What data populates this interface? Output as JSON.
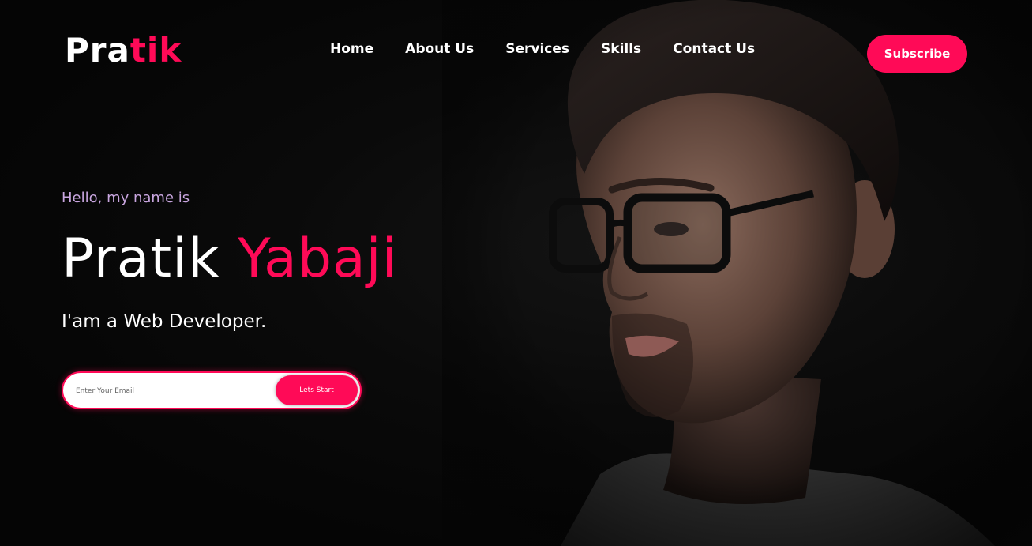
{
  "brand": {
    "logo_first": "Pra",
    "logo_second": "tik",
    "accent_color": "#ff0a57"
  },
  "nav": {
    "items": [
      {
        "label": "Home"
      },
      {
        "label": "About Us"
      },
      {
        "label": "Services"
      },
      {
        "label": "Skills"
      },
      {
        "label": "Contact Us"
      }
    ]
  },
  "header": {
    "subscribe_label": "Subscribe"
  },
  "hero": {
    "greeting": "Hello, my name is",
    "first_name": "Pratik",
    "last_name": "Yabaji",
    "role": "I'am a Web Developer.",
    "portrait_icon": "portrait-photo"
  },
  "signup": {
    "email_placeholder": "Enter Your Email",
    "email_value": "",
    "button_label": "Lets Start"
  }
}
